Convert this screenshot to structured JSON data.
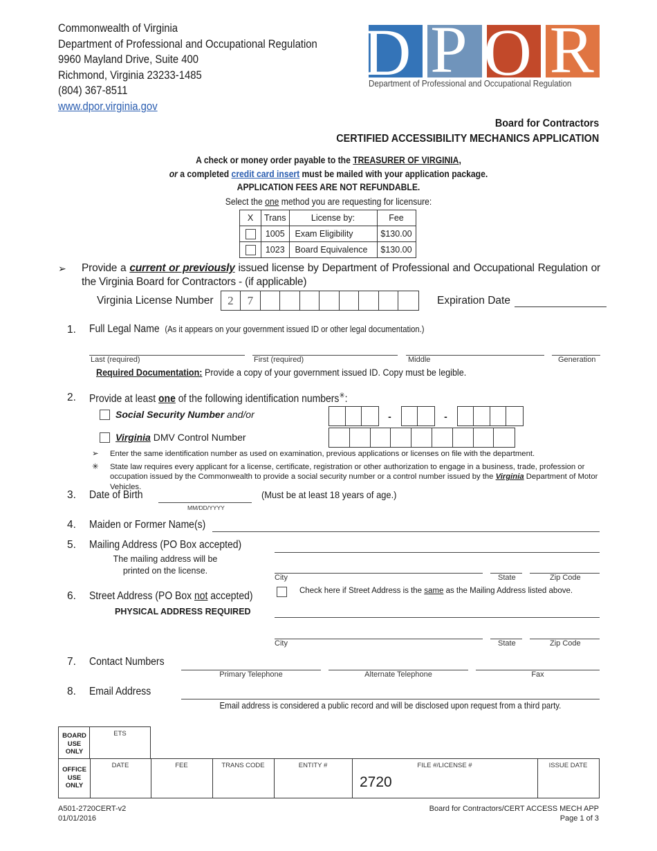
{
  "header": {
    "address_lines": [
      "Commonwealth of Virginia",
      "Department of Professional and Occupational Regulation",
      "9960 Mayland Drive, Suite 400",
      "Richmond, Virginia 23233-1485",
      "(804) 367-8511"
    ],
    "website": "www.dpor.virginia.gov",
    "logo": {
      "letters": [
        "D",
        "P",
        "O",
        "R"
      ],
      "tile_colors": [
        "#3474b8",
        "#7094bb",
        "#c2492a",
        "#e07542"
      ],
      "caption": "Department of Professional and Occupational Regulation"
    },
    "board_name": "Board for Contractors",
    "form_title": "CERTIFIED ACCESSIBILITY MECHANICS APPLICATION"
  },
  "payment": {
    "line1_prefix": "A check or money order payable to the ",
    "line1_payee": "TREASURER OF VIRGINIA",
    "line1_suffix": ",",
    "line2_or": "or",
    "line2_prefix": " a completed ",
    "line2_link": "credit card insert",
    "line2_suffix": " must be mailed with your application package.",
    "line3": "APPLICATION FEES ARE NOT REFUNDABLE.",
    "select_prefix": "Select the ",
    "select_one": "one",
    "select_suffix": " method you are requesting for licensure:"
  },
  "fee_table": {
    "headers": [
      "X",
      "Trans",
      "License by:",
      "Fee"
    ],
    "rows": [
      {
        "checked": false,
        "trans": "1005",
        "license_by": "Exam Eligibility",
        "fee": "$130.00"
      },
      {
        "checked": false,
        "trans": "1023",
        "license_by": "Board Equivalence",
        "fee": "$130.00"
      }
    ]
  },
  "license_section": {
    "bullet": "➢",
    "text_prefix": "Provide a ",
    "text_emph": "current or previously",
    "text_suffix": " issued license by Department of Professional and Occupational Regulation or the Virginia Board for Contractors -  (if applicable)",
    "license_label": "Virginia License Number",
    "license_digits": [
      "2",
      "7",
      "",
      "",
      "",
      "",
      "",
      "",
      "",
      ""
    ],
    "expiration_label": "Expiration Date",
    "expiration_value": ""
  },
  "items": {
    "full_name": {
      "num": "1.",
      "label": "Full Legal Name",
      "note": "(As it appears on your government issued ID or other legal documentation.)",
      "fields": [
        "Last  (required)",
        "First  (required)",
        "Middle",
        "Generation"
      ],
      "req_doc_label": "Required Documentation:",
      "req_doc_text": " Provide a copy of your government issued ID. Copy must be legible."
    },
    "identification": {
      "num": "2.",
      "label_prefix": "Provide at least ",
      "label_one": "one",
      "label_suffix": " of the following identification numbers",
      "asterisk": "✳",
      "colon": ":",
      "ssn_label": "Social Security Number",
      "ssn_suffix": "  and/or",
      "ssn_checked": false,
      "dmv_virginia": "Virginia",
      "dmv_label": " DMV Control Number",
      "dmv_checked": false,
      "ssn_dash": "-",
      "note1_bullet": "➢",
      "note1": "Enter the same identification number as used on examination, previous applications or licenses on file with the department.",
      "note2_bullet": "✳",
      "note2_prefix": "State law requires every applicant for a license, certificate, registration or other authorization to engage in a business, trade, profession or occupation issued by the Commonwealth to provide a social security number or a control number issued by the ",
      "note2_virginia": "Virginia",
      "note2_suffix": " Department of Motor Vehicles."
    },
    "dob": {
      "num": "3.",
      "label": "Date of Birth",
      "format": "MM/DD/YYYY",
      "note": "(Must be at least 18 years of age.)",
      "value": ""
    },
    "maiden": {
      "num": "4.",
      "label": "Maiden or Former Name(s)",
      "value": ""
    },
    "mailing": {
      "num": "5.",
      "label": "Mailing Address (PO Box accepted)",
      "note_line1": "The mailing address will be",
      "note_line2": "printed on the license.",
      "city": "City",
      "state": "State",
      "zip": "Zip Code"
    },
    "street": {
      "num": "6.",
      "label_prefix": "Street Address (PO Box  ",
      "label_not": "not",
      "label_suffix": "  accepted)",
      "sub": "PHYSICAL ADDRESS REQUIRED",
      "same_checked": false,
      "same_prefix": "Check here if Street Address is the ",
      "same_word": "same",
      "same_suffix": " as the Mailing Address listed above.",
      "city": "City",
      "state": "State",
      "zip": "Zip Code"
    },
    "contact": {
      "num": "7.",
      "label": "Contact Numbers",
      "fields": [
        "Primary Telephone",
        "Alternate Telephone",
        "Fax"
      ]
    },
    "email": {
      "num": "8.",
      "label": "Email Address",
      "note": "Email address is considered a public record and will be disclosed upon request from a third party."
    }
  },
  "office_use": {
    "board_label": [
      "BOARD",
      "USE",
      "ONLY"
    ],
    "ets_label": "ETS",
    "office_label": [
      "OFFICE",
      "USE",
      "ONLY"
    ],
    "columns": [
      "DATE",
      "FEE",
      "TRANS CODE",
      "ENTITY #",
      "FILE #/LICENSE #",
      "ISSUE DATE"
    ],
    "file_license_value": "2720"
  },
  "footer": {
    "form_id": "A501-2720CERT-v2",
    "date": "01/01/2016",
    "app_name": "Board for Contractors/CERT ACCESS MECH APP",
    "page": "Page 1 of 3"
  }
}
